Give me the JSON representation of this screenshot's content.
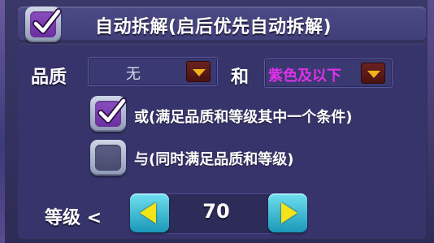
{
  "header": {
    "auto_dismantle_label": "自动拆解(启后优先自动拆解)",
    "auto_dismantle_checked": true
  },
  "quality": {
    "label": "品质",
    "value": "无",
    "value_color": "#d8d8e8",
    "dropdown_icon": "triangle-down-icon"
  },
  "and_label": "和",
  "color_filter": {
    "value": "紫色及以下",
    "value_color": "#e030e8",
    "dropdown_icon": "triangle-down-icon"
  },
  "options": [
    {
      "label": "或(满足品质和等级其中一个条件)",
      "checked": true
    },
    {
      "label": "与(同时满足品质和等级)",
      "checked": false
    }
  ],
  "level": {
    "label": "等级 <",
    "value": "70",
    "decrease_icon": "triangle-left-icon",
    "increase_icon": "triangle-right-icon"
  },
  "colors": {
    "accent_purple": "#7a3fb4",
    "button_cyan": "#1a98b8",
    "arrow_yellow": "#f2e31a",
    "dropdown_red": "#5a1a18"
  }
}
